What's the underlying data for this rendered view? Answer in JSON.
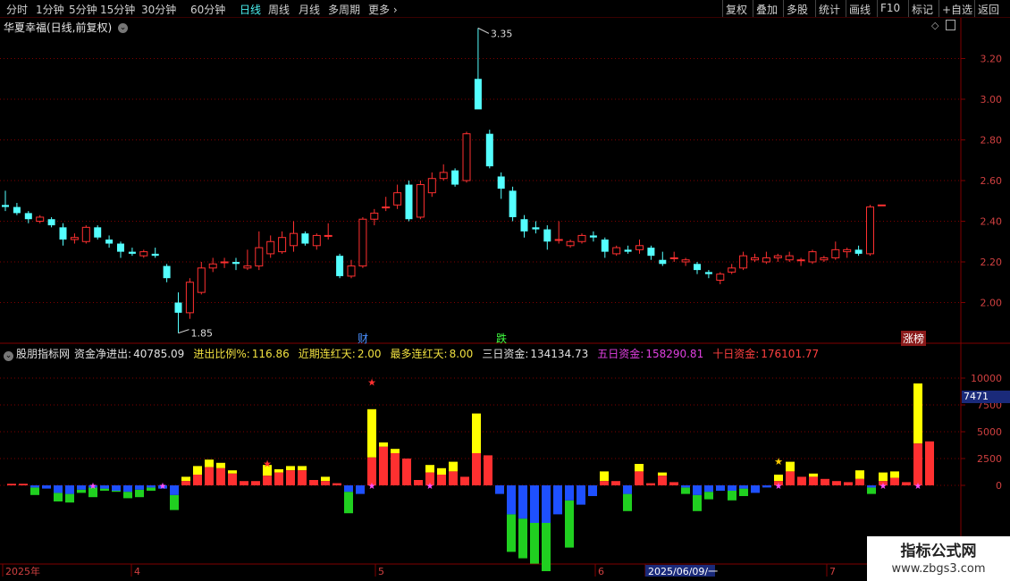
{
  "toolbar": {
    "left": [
      "分时",
      "1分钟",
      "5分钟",
      "15分钟",
      "30分钟",
      "60分钟",
      "日线",
      "周线",
      "月线",
      "多周期",
      "更多"
    ],
    "active": "日线",
    "right": [
      "复权",
      "叠加",
      "多股",
      "统计",
      "画线",
      "F10",
      "标记",
      "+自选",
      "返回"
    ]
  },
  "main": {
    "title": "华夏幸福(日线,前复权)",
    "high_label": "3.35",
    "low_label": "1.85",
    "price_axis": [
      "3.20",
      "3.00",
      "2.80",
      "2.60",
      "2.40",
      "2.20",
      "2.00"
    ],
    "tags": {
      "cai": "财",
      "die": "跌",
      "zhangbang": "涨榜"
    }
  },
  "indicator": {
    "name": "股朋指标网",
    "fields": [
      {
        "label": "资金净进出:",
        "value": "40785.09",
        "color": "#e0e0e0"
      },
      {
        "label": "进出比例%:",
        "value": "116.86",
        "color": "#f0e040"
      },
      {
        "label": "近期连红天:",
        "value": "2.00",
        "color": "#f0e040"
      },
      {
        "label": "最多连红天:",
        "value": "8.00",
        "color": "#f0e040"
      },
      {
        "label": "三日资金:",
        "value": "134134.73",
        "color": "#e0e0e0"
      },
      {
        "label": "五日资金:",
        "value": "158290.81",
        "color": "#e040e0"
      },
      {
        "label": "十日资金:",
        "value": "176101.77",
        "color": "#ff4040"
      }
    ],
    "axis": [
      "10000",
      "7500",
      "5000",
      "2500",
      "0"
    ],
    "axis_badge": "7471"
  },
  "time_axis": {
    "labels": [
      "2025年",
      "4",
      "5",
      "6",
      "2025/06/09/一",
      "7"
    ]
  },
  "watermark": {
    "title": "指标公式网",
    "url": "www.zbgs3.com"
  },
  "colors": {
    "up": "#ff3030",
    "down": "#54ffff",
    "grid": "#800000",
    "yellow": "#ffff00",
    "blue": "#1e50ff",
    "green": "#20d020"
  },
  "chart_data": [
    {
      "type": "candlestick",
      "title": "华夏幸福(日线,前复权)",
      "ylim": [
        1.8,
        3.4
      ],
      "candles": [
        [
          2.48,
          2.55,
          2.45,
          2.47
        ],
        [
          2.47,
          2.49,
          2.43,
          2.44
        ],
        [
          2.44,
          2.45,
          2.39,
          2.41
        ],
        [
          2.4,
          2.43,
          2.39,
          2.42
        ],
        [
          2.41,
          2.42,
          2.37,
          2.38
        ],
        [
          2.37,
          2.39,
          2.28,
          2.31
        ],
        [
          2.31,
          2.34,
          2.29,
          2.32
        ],
        [
          2.3,
          2.38,
          2.29,
          2.37
        ],
        [
          2.37,
          2.38,
          2.31,
          2.32
        ],
        [
          2.31,
          2.33,
          2.27,
          2.29
        ],
        [
          2.29,
          2.3,
          2.22,
          2.25
        ],
        [
          2.25,
          2.27,
          2.23,
          2.24
        ],
        [
          2.23,
          2.26,
          2.22,
          2.25
        ],
        [
          2.24,
          2.27,
          2.22,
          2.23
        ],
        [
          2.18,
          2.19,
          2.1,
          2.12
        ],
        [
          2.0,
          2.05,
          1.85,
          1.95
        ],
        [
          1.95,
          2.12,
          1.92,
          2.1
        ],
        [
          2.05,
          2.2,
          2.04,
          2.17
        ],
        [
          2.17,
          2.22,
          2.15,
          2.19
        ],
        [
          2.2,
          2.22,
          2.17,
          2.2
        ],
        [
          2.2,
          2.22,
          2.16,
          2.19
        ],
        [
          2.17,
          2.26,
          2.16,
          2.18
        ],
        [
          2.18,
          2.35,
          2.16,
          2.27
        ],
        [
          2.24,
          2.33,
          2.22,
          2.3
        ],
        [
          2.25,
          2.35,
          2.24,
          2.32
        ],
        [
          2.28,
          2.4,
          2.25,
          2.34
        ],
        [
          2.34,
          2.35,
          2.28,
          2.29
        ],
        [
          2.28,
          2.34,
          2.26,
          2.33
        ],
        [
          2.33,
          2.39,
          2.31,
          2.33
        ],
        [
          2.23,
          2.24,
          2.12,
          2.13
        ],
        [
          2.13,
          2.21,
          2.12,
          2.18
        ],
        [
          2.18,
          2.42,
          2.17,
          2.41
        ],
        [
          2.41,
          2.46,
          2.38,
          2.44
        ],
        [
          2.47,
          2.52,
          2.45,
          2.47
        ],
        [
          2.48,
          2.58,
          2.46,
          2.54
        ],
        [
          2.58,
          2.6,
          2.4,
          2.41
        ],
        [
          2.42,
          2.6,
          2.41,
          2.58
        ],
        [
          2.54,
          2.64,
          2.52,
          2.61
        ],
        [
          2.61,
          2.68,
          2.6,
          2.64
        ],
        [
          2.65,
          2.66,
          2.57,
          2.58
        ],
        [
          2.6,
          2.84,
          2.59,
          2.83
        ],
        [
          3.1,
          3.35,
          3.02,
          2.95
        ],
        [
          2.83,
          2.85,
          2.66,
          2.67
        ],
        [
          2.62,
          2.64,
          2.51,
          2.56
        ],
        [
          2.55,
          2.57,
          2.4,
          2.42
        ],
        [
          2.41,
          2.43,
          2.32,
          2.35
        ],
        [
          2.37,
          2.4,
          2.34,
          2.36
        ],
        [
          2.36,
          2.38,
          2.26,
          2.3
        ],
        [
          2.31,
          2.4,
          2.29,
          2.31
        ],
        [
          2.28,
          2.31,
          2.27,
          2.3
        ],
        [
          2.3,
          2.34,
          2.29,
          2.33
        ],
        [
          2.33,
          2.35,
          2.3,
          2.32
        ],
        [
          2.31,
          2.32,
          2.22,
          2.25
        ],
        [
          2.24,
          2.28,
          2.23,
          2.27
        ],
        [
          2.26,
          2.28,
          2.24,
          2.25
        ],
        [
          2.26,
          2.31,
          2.24,
          2.28
        ],
        [
          2.27,
          2.28,
          2.21,
          2.23
        ],
        [
          2.21,
          2.25,
          2.18,
          2.19
        ],
        [
          2.22,
          2.25,
          2.2,
          2.22
        ],
        [
          2.2,
          2.22,
          2.18,
          2.21
        ],
        [
          2.19,
          2.2,
          2.14,
          2.16
        ],
        [
          2.15,
          2.16,
          2.12,
          2.14
        ],
        [
          2.11,
          2.15,
          2.09,
          2.14
        ],
        [
          2.15,
          2.19,
          2.14,
          2.17
        ],
        [
          2.17,
          2.25,
          2.16,
          2.23
        ],
        [
          2.21,
          2.24,
          2.2,
          2.22
        ],
        [
          2.2,
          2.25,
          2.19,
          2.22
        ],
        [
          2.22,
          2.24,
          2.2,
          2.23
        ],
        [
          2.21,
          2.25,
          2.2,
          2.23
        ],
        [
          2.21,
          2.22,
          2.18,
          2.21
        ],
        [
          2.2,
          2.26,
          2.19,
          2.25
        ],
        [
          2.21,
          2.23,
          2.2,
          2.22
        ],
        [
          2.22,
          2.3,
          2.21,
          2.26
        ],
        [
          2.25,
          2.27,
          2.22,
          2.26
        ],
        [
          2.26,
          2.28,
          2.23,
          2.24
        ],
        [
          2.24,
          2.48,
          2.23,
          2.47
        ],
        [
          2.48,
          2.48,
          2.48,
          2.48
        ]
      ]
    },
    {
      "type": "bar",
      "ylim": [
        -3500,
        12000
      ],
      "series_note": "stacked: red/yellow positive, blue/green negative",
      "values": [
        [
          150,
          0
        ],
        [
          150,
          0
        ],
        [
          -200,
          -900
        ],
        [
          -300,
          0
        ],
        [
          -700,
          -1500
        ],
        [
          -800,
          -1600
        ],
        [
          -400,
          -700
        ],
        [
          -200,
          -1100
        ],
        [
          -300,
          -500
        ],
        [
          -500,
          -600
        ],
        [
          -600,
          -1200
        ],
        [
          -400,
          -1100
        ],
        [
          -200,
          -500
        ],
        [
          -300,
          0
        ],
        [
          -900,
          -2300
        ],
        [
          400,
          800
        ],
        [
          1000,
          1800
        ],
        [
          1700,
          2400
        ],
        [
          1600,
          2100
        ],
        [
          1100,
          1400
        ],
        [
          400,
          0
        ],
        [
          400,
          0
        ],
        [
          900,
          1900
        ],
        [
          1200,
          1500
        ],
        [
          1400,
          1800
        ],
        [
          1400,
          1800
        ],
        [
          500,
          0
        ],
        [
          400,
          800
        ],
        [
          200,
          0
        ],
        [
          -600,
          -2600
        ],
        [
          -800,
          0
        ],
        [
          2600,
          7100
        ],
        [
          3600,
          4000
        ],
        [
          3000,
          3400
        ],
        [
          2500,
          0
        ],
        [
          500,
          0
        ],
        [
          1200,
          1900
        ],
        [
          1000,
          1600
        ],
        [
          1300,
          2200
        ],
        [
          800,
          0
        ],
        [
          3000,
          6700
        ],
        [
          2800,
          0
        ],
        [
          -800,
          0
        ],
        [
          -2700,
          -6200
        ],
        [
          -3100,
          -6800
        ],
        [
          -3500,
          -7300
        ],
        [
          -3500,
          -8000
        ],
        [
          -2700,
          0
        ],
        [
          -1400,
          -5800
        ],
        [
          -1800,
          0
        ],
        [
          -1000,
          0
        ],
        [
          400,
          1300
        ],
        [
          400,
          0
        ],
        [
          -800,
          -2400
        ],
        [
          1300,
          2000
        ],
        [
          200,
          0
        ],
        [
          900,
          1200
        ],
        [
          300,
          0
        ],
        [
          -200,
          -800
        ],
        [
          -900,
          -2400
        ],
        [
          -600,
          -1300
        ],
        [
          -500,
          0
        ],
        [
          -500,
          -1400
        ],
        [
          -300,
          -1000
        ],
        [
          -700,
          0
        ],
        [
          -200,
          0
        ],
        [
          400,
          1000
        ],
        [
          1300,
          2200
        ],
        [
          800,
          0
        ],
        [
          800,
          1100
        ],
        [
          600,
          0
        ],
        [
          400,
          0
        ],
        [
          300,
          0
        ],
        [
          600,
          1400
        ],
        [
          -200,
          -800
        ],
        [
          400,
          1200
        ],
        [
          700,
          1300
        ],
        [
          300,
          0
        ],
        [
          3900,
          9500
        ],
        [
          4100,
          0
        ]
      ]
    }
  ]
}
